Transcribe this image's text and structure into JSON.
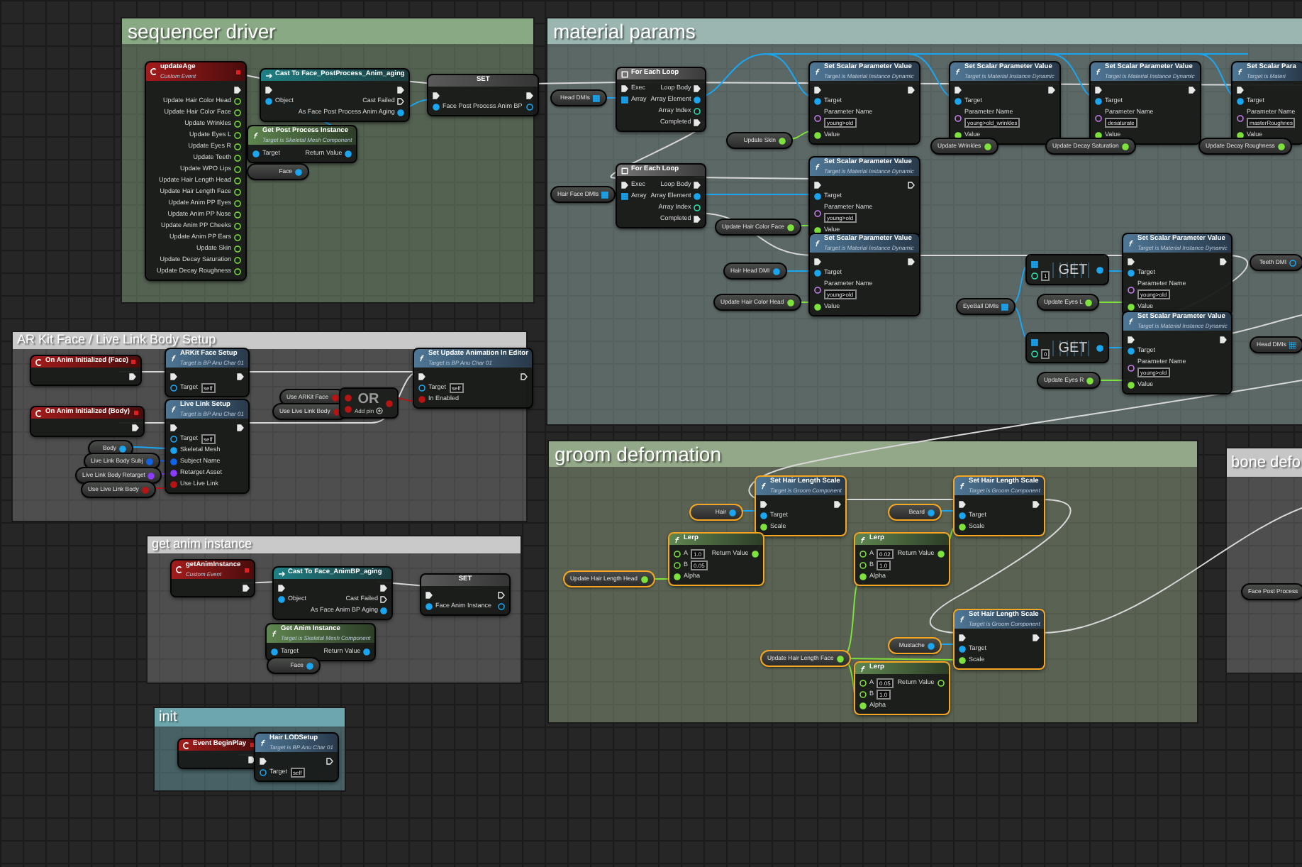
{
  "comments": [
    {
      "title": "sequencer driver",
      "color": "#89a884",
      "nodes": [
        {
          "kind": "event",
          "title": "updateAge",
          "subtitle": "Custom Event",
          "selected": false,
          "outputs": [
            {
              "kind": "exec",
              "connected": true
            },
            {
              "kind": "float",
              "label": "Update Hair Color Head",
              "connected": false
            },
            {
              "kind": "float",
              "label": "Update Hair Color Face",
              "connected": false
            },
            {
              "kind": "float",
              "label": "Update Wrinkles",
              "connected": false
            },
            {
              "kind": "float",
              "label": "Update Eyes L",
              "connected": false
            },
            {
              "kind": "float",
              "label": "Update Eyes R",
              "connected": false
            },
            {
              "kind": "float",
              "label": "Update Teeth",
              "connected": false
            },
            {
              "kind": "float",
              "label": "Update WPO Lips",
              "connected": false
            },
            {
              "kind": "float",
              "label": "Update Hair Length Head",
              "connected": false
            },
            {
              "kind": "float",
              "label": "Update Hair Length Face",
              "connected": false
            },
            {
              "kind": "float",
              "label": "Update Anim PP Eyes",
              "connected": false
            },
            {
              "kind": "float",
              "label": "Update Anim PP Nose",
              "connected": false
            },
            {
              "kind": "float",
              "label": "Update Anim PP Cheeks",
              "connected": false
            },
            {
              "kind": "float",
              "label": "Update Anim PP Ears",
              "connected": false
            },
            {
              "kind": "float",
              "label": "Update Skin",
              "connected": false
            },
            {
              "kind": "float",
              "label": "Update Decay Saturation",
              "connected": false
            },
            {
              "kind": "float",
              "label": "Update Decay Roughness",
              "connected": false
            }
          ]
        },
        {
          "kind": "cast",
          "title": "Cast To Face_PostProcess_Anim_aging",
          "selected": false,
          "inputs": [
            {
              "kind": "exec",
              "connected": true
            },
            {
              "kind": "object",
              "label": "Object",
              "connected": true
            }
          ],
          "outputs": [
            {
              "kind": "exec",
              "connected": true
            },
            {
              "kind": "exec",
              "label": "Cast Failed",
              "connected": false
            },
            {
              "kind": "object",
              "label": "As Face Post Process Anim Aging",
              "connected": true
            }
          ]
        },
        {
          "kind": "set",
          "title": "SET",
          "selected": false,
          "inputs": [
            {
              "kind": "exec",
              "connected": true
            },
            {
              "kind": "object",
              "label": "Face Post Process Anim BP",
              "connected": true
            }
          ],
          "outputs": [
            {
              "kind": "exec",
              "connected": true
            },
            {
              "kind": "object",
              "connected": false
            }
          ]
        },
        {
          "kind": "pure",
          "title": "Get Post Process Instance",
          "subtitle": "Target is Skeletal Mesh Component",
          "selected": false,
          "inputs": [
            {
              "kind": "object",
              "label": "Target",
              "connected": true
            }
          ],
          "outputs": [
            {
              "kind": "object",
              "label": "Return Value",
              "connected": true
            }
          ]
        },
        {
          "kind": "variable",
          "label": "Face",
          "pin": {
            "kind": "object",
            "connected": true
          },
          "selected": false
        }
      ]
    },
    {
      "title": "material params",
      "color": "#9bb5b0",
      "nodes": [
        {
          "kind": "variable",
          "label": "Head DMIs",
          "pin": {
            "kind": "array",
            "connected": true
          },
          "selected": false
        },
        {
          "kind": "loop",
          "title": "For Each Loop",
          "selected": false,
          "inputs": [
            {
              "kind": "exec",
              "label": "Exec",
              "connected": true
            },
            {
              "kind": "array",
              "label": "Array",
              "connected": true
            }
          ],
          "outputs": [
            {
              "kind": "exec",
              "label": "Loop Body",
              "connected": true
            },
            {
              "kind": "object",
              "label": "Array Element",
              "connected": true
            },
            {
              "kind": "int",
              "label": "Array Index",
              "connected": false
            },
            {
              "kind": "exec",
              "label": "Completed",
              "connected": true
            }
          ]
        },
        {
          "kind": "function",
          "title": "Set Scalar Parameter Value",
          "subtitle": "Target is Material Instance Dynamic",
          "selected": false,
          "inputs": [
            {
              "kind": "exec",
              "connected": true
            },
            {
              "kind": "object",
              "label": "Target",
              "connected": true
            },
            {
              "kind": "name",
              "label": "Parameter Name",
              "value": "young>old",
              "connected": false
            },
            {
              "kind": "float",
              "label": "Value",
              "connected": true
            }
          ],
          "outputs": [
            {
              "kind": "exec",
              "connected": true
            }
          ]
        },
        {
          "kind": "function",
          "title": "Set Scalar Parameter Value",
          "subtitle": "Target is Material Instance Dynamic",
          "selected": false,
          "inputs": [
            {
              "kind": "exec",
              "connected": true
            },
            {
              "kind": "object",
              "label": "Target",
              "connected": true
            },
            {
              "kind": "name",
              "label": "Parameter Name",
              "value": "young>old_wrinkles",
              "connected": false
            },
            {
              "kind": "float",
              "label": "Value",
              "connected": true
            }
          ],
          "outputs": [
            {
              "kind": "exec",
              "connected": true
            }
          ]
        },
        {
          "kind": "function",
          "title": "Set Scalar Parameter Value",
          "subtitle": "Target is Material Instance Dynamic",
          "selected": false,
          "inputs": [
            {
              "kind": "exec",
              "connected": true
            },
            {
              "kind": "object",
              "label": "Target",
              "connected": true
            },
            {
              "kind": "name",
              "label": "Parameter Name",
              "value": "desaturate",
              "connected": false
            },
            {
              "kind": "float",
              "label": "Value",
              "connected": true
            }
          ],
          "outputs": [
            {
              "kind": "exec",
              "connected": true
            }
          ]
        },
        {
          "kind": "function",
          "title": "Set Scalar Para",
          "subtitle": "Target is Materi",
          "selected": false,
          "inputs": [
            {
              "kind": "exec",
              "connected": true
            },
            {
              "kind": "object",
              "label": "Target",
              "connected": true
            },
            {
              "kind": "name",
              "label": "Parameter Name",
              "value": "masterRoughnes",
              "connected": false
            },
            {
              "kind": "float",
              "label": "Value",
              "connected": true
            }
          ]
        },
        {
          "kind": "variable",
          "label": "Update Skin",
          "pin": {
            "kind": "float",
            "connected": true
          },
          "selected": false
        },
        {
          "kind": "variable",
          "label": "Update Wrinkles",
          "pin": {
            "kind": "float",
            "connected": true
          },
          "selected": false
        },
        {
          "kind": "variable",
          "label": "Update Decay Saturation",
          "pin": {
            "kind": "float",
            "connected": true
          },
          "selected": false
        },
        {
          "kind": "variable",
          "label": "Update Decay Roughness",
          "pin": {
            "kind": "float",
            "connected": true
          },
          "selected": false
        },
        {
          "kind": "variable",
          "label": "Hair Face DMIs",
          "pin": {
            "kind": "array",
            "connected": true
          },
          "selected": false
        },
        {
          "kind": "loop",
          "title": "For Each Loop",
          "selected": false,
          "inputs": [
            {
              "kind": "exec",
              "label": "Exec",
              "connected": true
            },
            {
              "kind": "array",
              "label": "Array",
              "connected": true
            }
          ],
          "outputs": [
            {
              "kind": "exec",
              "label": "Loop Body",
              "connected": true
            },
            {
              "kind": "object",
              "label": "Array Element",
              "connected": true
            },
            {
              "kind": "int",
              "label": "Array Index",
              "connected": false
            },
            {
              "kind": "exec",
              "label": "Completed",
              "connected": true
            }
          ]
        },
        {
          "kind": "variable",
          "label": "Update Hair Color Face",
          "pin": {
            "kind": "float",
            "connected": true
          },
          "selected": false
        },
        {
          "kind": "function",
          "title": "Set Scalar Parameter Value",
          "subtitle": "Target is Material Instance Dynamic",
          "selected": false,
          "inputs": [
            {
              "kind": "exec",
              "connected": true
            },
            {
              "kind": "object",
              "label": "Target",
              "connected": true
            },
            {
              "kind": "name",
              "label": "Parameter Name",
              "value": "young>old",
              "connected": false
            },
            {
              "kind": "float",
              "label": "Value",
              "connected": true
            }
          ],
          "outputs": [
            {
              "kind": "exec",
              "connected": false
            }
          ]
        },
        {
          "kind": "variable",
          "label": "Hair Head DMI",
          "pin": {
            "kind": "object",
            "connected": true
          },
          "selected": false
        },
        {
          "kind": "function",
          "title": "Set Scalar Parameter Value",
          "subtitle": "Target is Material Instance Dynamic",
          "selected": false,
          "inputs": [
            {
              "kind": "exec",
              "connected": true
            },
            {
              "kind": "object",
              "label": "Target",
              "connected": true
            },
            {
              "kind": "name",
              "label": "Parameter Name",
              "value": "young>old",
              "connected": false
            },
            {
              "kind": "float",
              "label": "Value",
              "connected": true
            }
          ],
          "outputs": [
            {
              "kind": "exec",
              "connected": true
            }
          ]
        },
        {
          "kind": "array-get",
          "title": "GET",
          "selected": false,
          "inputs": [
            {
              "kind": "array",
              "connected": true
            },
            {
              "kind": "int",
              "value": "1",
              "connected": false
            }
          ],
          "outputs": [
            {
              "kind": "object",
              "connected": true
            }
          ]
        },
        {
          "kind": "function",
          "title": "Set Scalar Parameter Value",
          "subtitle": "Target is Material Instance Dynamic",
          "selected": false,
          "inputs": [
            {
              "kind": "exec",
              "connected": true
            },
            {
              "kind": "object",
              "label": "Target",
              "connected": true
            },
            {
              "kind": "name",
              "label": "Parameter Name",
              "value": "young>old",
              "connected": false
            },
            {
              "kind": "float",
              "label": "Value",
              "connected": true
            }
          ],
          "outputs": [
            {
              "kind": "exec",
              "connected": true
            }
          ]
        },
        {
          "kind": "variable",
          "label": "Teeth DMI",
          "pin": {
            "kind": "object",
            "connected": false
          },
          "selected": false
        },
        {
          "kind": "variable",
          "label": "Update Hair Color Head",
          "pin": {
            "kind": "float",
            "connected": true
          },
          "selected": false
        },
        {
          "kind": "variable",
          "label": "EyeBall DMIs",
          "pin": {
            "kind": "array",
            "connected": true
          },
          "selected": false
        },
        {
          "kind": "variable",
          "label": "Update Eyes L",
          "pin": {
            "kind": "float",
            "connected": true
          },
          "selected": false
        },
        {
          "kind": "array-get",
          "title": "GET",
          "selected": false,
          "inputs": [
            {
              "kind": "array",
              "connected": true
            },
            {
              "kind": "int",
              "value": "0",
              "connected": false
            }
          ],
          "outputs": [
            {
              "kind": "object",
              "connected": true
            }
          ]
        },
        {
          "kind": "function",
          "title": "Set Scalar Parameter Value",
          "subtitle": "Target is Material Instance Dynamic",
          "selected": false,
          "inputs": [
            {
              "kind": "exec",
              "connected": true
            },
            {
              "kind": "object",
              "label": "Target",
              "connected": true
            },
            {
              "kind": "name",
              "label": "Parameter Name",
              "value": "young>old",
              "connected": false
            },
            {
              "kind": "float",
              "label": "Value",
              "connected": true
            }
          ],
          "outputs": [
            {
              "kind": "exec",
              "connected": true
            }
          ]
        },
        {
          "kind": "variable",
          "label": "Head DMIs",
          "pin": {
            "kind": "array",
            "connected": false
          },
          "selected": false
        },
        {
          "kind": "variable",
          "label": "Update Eyes R",
          "pin": {
            "kind": "float",
            "connected": true
          },
          "selected": false
        }
      ]
    },
    {
      "title": "AR Kit Face / Live Link Body Setup",
      "color": "#c9c9c9",
      "nodes": [
        {
          "kind": "event",
          "title": "On Anim Initialized (Face)",
          "selected": false,
          "outputs": [
            {
              "kind": "exec",
              "connected": true
            }
          ]
        },
        {
          "kind": "function",
          "title": "ARKit Face Setup",
          "subtitle": "Target is BP Anu Char 01",
          "selected": false,
          "inputs": [
            {
              "kind": "exec",
              "connected": true
            },
            {
              "kind": "object",
              "label": "Target",
              "value": "self",
              "connected": false
            }
          ],
          "outputs": [
            {
              "kind": "exec",
              "connected": true
            }
          ]
        },
        {
          "kind": "variable",
          "label": "Use ARKit Face",
          "pin": {
            "kind": "bool",
            "connected": true
          },
          "selected": false
        },
        {
          "kind": "variable",
          "label": "Use Live Link Body",
          "pin": {
            "kind": "bool",
            "connected": true
          },
          "selected": false
        },
        {
          "kind": "operator",
          "title": "OR",
          "add_pin": "Add pin",
          "selected": false,
          "inputs": [
            {
              "kind": "bool",
              "connected": true
            },
            {
              "kind": "bool",
              "connected": true
            }
          ],
          "outputs": [
            {
              "kind": "bool",
              "connected": true
            }
          ]
        },
        {
          "kind": "function",
          "title": "Set Update Animation In Editor",
          "subtitle": "Target is BP Anu Char 01",
          "selected": false,
          "inputs": [
            {
              "kind": "exec",
              "connected": true
            },
            {
              "kind": "object",
              "label": "Target",
              "value": "self",
              "connected": false
            },
            {
              "kind": "bool",
              "label": "In Enabled",
              "connected": true
            }
          ],
          "outputs": [
            {
              "kind": "exec",
              "connected": false
            }
          ]
        },
        {
          "kind": "event",
          "title": "On Anim Initialized (Body)",
          "selected": false,
          "outputs": [
            {
              "kind": "exec",
              "connected": true
            }
          ]
        },
        {
          "kind": "function",
          "title": "Live Link Setup",
          "subtitle": "Target is BP Anu Char 01",
          "selected": false,
          "inputs": [
            {
              "kind": "exec",
              "connected": true
            },
            {
              "kind": "object",
              "label": "Target",
              "value": "self",
              "connected": false
            },
            {
              "kind": "object",
              "label": "Skeletal Mesh",
              "connected": true
            },
            {
              "kind": "struct",
              "label": "Subject Name",
              "connected": true
            },
            {
              "kind": "asset",
              "label": "Retarget Asset",
              "connected": true
            },
            {
              "kind": "bool",
              "label": "Use Live Link",
              "connected": true
            }
          ],
          "outputs": [
            {
              "kind": "exec",
              "connected": true
            }
          ]
        },
        {
          "kind": "variable",
          "label": "Body",
          "pin": {
            "kind": "object",
            "connected": true
          },
          "selected": false
        },
        {
          "kind": "variable",
          "label": "Live Link Body Subj",
          "pin": {
            "kind": "struct",
            "connected": true
          },
          "selected": false
        },
        {
          "kind": "variable",
          "label": "Live Link Body Retarget",
          "pin": {
            "kind": "asset",
            "connected": true
          },
          "selected": false
        },
        {
          "kind": "variable",
          "label": "Use Live Link Body",
          "pin": {
            "kind": "bool",
            "connected": true
          },
          "selected": false
        }
      ]
    },
    {
      "title": "get anim instance",
      "color": "#c9c9c9",
      "nodes": [
        {
          "kind": "event",
          "title": "getAnimInstance",
          "subtitle": "Custom Event",
          "selected": false,
          "outputs": [
            {
              "kind": "exec",
              "connected": true
            }
          ]
        },
        {
          "kind": "cast",
          "title": "Cast To Face_AnimBP_aging",
          "selected": false,
          "inputs": [
            {
              "kind": "exec",
              "connected": true
            },
            {
              "kind": "object",
              "label": "Object",
              "connected": true
            }
          ],
          "outputs": [
            {
              "kind": "exec",
              "connected": true
            },
            {
              "kind": "exec",
              "label": "Cast Failed",
              "connected": false
            },
            {
              "kind": "object",
              "label": "As Face Anim BP Aging",
              "connected": true
            }
          ]
        },
        {
          "kind": "set",
          "title": "SET",
          "selected": false,
          "inputs": [
            {
              "kind": "exec",
              "connected": true
            },
            {
              "kind": "object",
              "label": "Face Anim Instance",
              "connected": true
            }
          ],
          "outputs": [
            {
              "kind": "exec",
              "connected": false
            },
            {
              "kind": "object",
              "connected": false
            }
          ]
        },
        {
          "kind": "pure",
          "title": "Get Anim Instance",
          "subtitle": "Target is Skeletal Mesh Component",
          "selected": false,
          "inputs": [
            {
              "kind": "object",
              "label": "Target",
              "connected": true
            }
          ],
          "outputs": [
            {
              "kind": "object",
              "label": "Return Value",
              "connected": true
            }
          ]
        },
        {
          "kind": "variable",
          "label": "Face",
          "pin": {
            "kind": "object",
            "connected": true
          },
          "selected": false
        }
      ]
    },
    {
      "title": "init",
      "color": "#6ea6ad",
      "nodes": [
        {
          "kind": "event",
          "title": "Event BeginPlay",
          "selected": false,
          "outputs": [
            {
              "kind": "exec",
              "connected": true
            }
          ]
        },
        {
          "kind": "function",
          "title": "Hair LODSetup",
          "subtitle": "Target is BP Anu Char 01",
          "selected": false,
          "inputs": [
            {
              "kind": "exec",
              "connected": true
            },
            {
              "kind": "object",
              "label": "Target",
              "value": "self",
              "connected": false
            }
          ],
          "outputs": [
            {
              "kind": "exec",
              "connected": false
            }
          ]
        }
      ]
    },
    {
      "title": "groom deformation",
      "color": "#93a888",
      "nodes": [
        {
          "kind": "variable",
          "label": "Hair",
          "pin": {
            "kind": "object",
            "connected": true
          },
          "selected": true
        },
        {
          "kind": "function",
          "title": "Set Hair Length Scale",
          "subtitle": "Target is Groom Component",
          "selected": true,
          "inputs": [
            {
              "kind": "exec",
              "connected": true
            },
            {
              "kind": "object",
              "label": "Target",
              "connected": true
            },
            {
              "kind": "float",
              "label": "Scale",
              "connected": true
            }
          ],
          "outputs": [
            {
              "kind": "exec",
              "connected": true
            }
          ]
        },
        {
          "kind": "variable",
          "label": "Beard",
          "pin": {
            "kind": "object",
            "connected": true
          },
          "selected": true
        },
        {
          "kind": "function",
          "title": "Set Hair Length Scale",
          "subtitle": "Target is Groom Component",
          "selected": true,
          "inputs": [
            {
              "kind": "exec",
              "connected": true
            },
            {
              "kind": "object",
              "label": "Target",
              "connected": true
            },
            {
              "kind": "float",
              "label": "Scale",
              "connected": true
            }
          ],
          "outputs": [
            {
              "kind": "exec",
              "connected": true
            }
          ]
        },
        {
          "kind": "pure",
          "title": "Lerp",
          "selected": true,
          "inputs": [
            {
              "kind": "float",
              "label": "A",
              "value": "1.0",
              "connected": false
            },
            {
              "kind": "float",
              "label": "B",
              "value": "0.05",
              "connected": false
            },
            {
              "kind": "float",
              "label": "Alpha",
              "connected": true
            }
          ],
          "outputs": [
            {
              "kind": "float",
              "label": "Return Value",
              "connected": true
            }
          ]
        },
        {
          "kind": "pure",
          "title": "Lerp",
          "selected": true,
          "inputs": [
            {
              "kind": "float",
              "label": "A",
              "value": "0.02",
              "connected": false
            },
            {
              "kind": "float",
              "label": "B",
              "value": "1.0",
              "connected": false
            },
            {
              "kind": "float",
              "label": "Alpha",
              "connected": true
            }
          ],
          "outputs": [
            {
              "kind": "float",
              "label": "Return Value",
              "connected": true
            }
          ]
        },
        {
          "kind": "variable",
          "label": "Update Hair Length Head",
          "pin": {
            "kind": "float",
            "connected": true
          },
          "selected": true
        },
        {
          "kind": "variable",
          "label": "Update Hair Length Face",
          "pin": {
            "kind": "float",
            "connected": true
          },
          "selected": true
        },
        {
          "kind": "variable",
          "label": "Mustache",
          "pin": {
            "kind": "object",
            "connected": true
          },
          "selected": true
        },
        {
          "kind": "function",
          "title": "Set Hair Length Scale",
          "subtitle": "Target is Groom Component",
          "selected": true,
          "inputs": [
            {
              "kind": "exec",
              "connected": true
            },
            {
              "kind": "object",
              "label": "Target",
              "connected": true
            },
            {
              "kind": "float",
              "label": "Scale",
              "connected": true
            }
          ],
          "outputs": [
            {
              "kind": "exec",
              "connected": true
            }
          ]
        },
        {
          "kind": "pure",
          "title": "Lerp",
          "selected": true,
          "inputs": [
            {
              "kind": "float",
              "label": "A",
              "value": "0.05",
              "connected": false
            },
            {
              "kind": "float",
              "label": "B",
              "value": "1.0",
              "connected": false
            },
            {
              "kind": "float",
              "label": "Alpha",
              "connected": true
            }
          ],
          "outputs": [
            {
              "kind": "float",
              "label": "Return Value",
              "connected": false
            }
          ]
        }
      ]
    },
    {
      "title": "bone defo",
      "color": "#c6c6c6",
      "nodes": [
        {
          "kind": "variable",
          "label": "Face Post Process",
          "selected": false
        }
      ]
    }
  ]
}
